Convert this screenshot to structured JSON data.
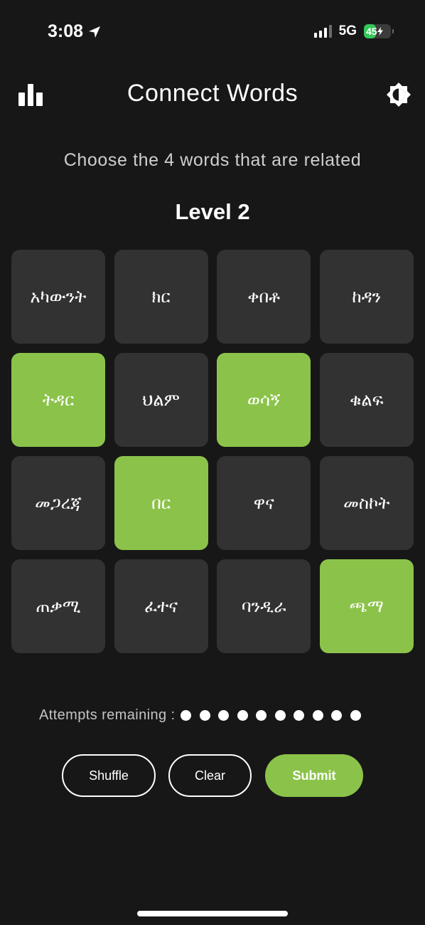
{
  "status_bar": {
    "time": "3:08",
    "network": "5G",
    "battery": "45",
    "battery_fraction": 0.45,
    "location_icon": "location-arrow-icon",
    "signal_icon": "cellular-signal-icon"
  },
  "header": {
    "title": "Connect Words",
    "stats_icon": "bar-chart-icon",
    "theme_icon": "brightness-icon"
  },
  "instruction": "Choose the 4 words that are related",
  "level": "Level 2",
  "tiles": [
    {
      "label": "አካውንት",
      "selected": false
    },
    {
      "label": "ክር",
      "selected": false
    },
    {
      "label": "ቀበቶ",
      "selected": false
    },
    {
      "label": "ከዳን",
      "selected": false
    },
    {
      "label": "ትዳር",
      "selected": true
    },
    {
      "label": "ህልም",
      "selected": false
    },
    {
      "label": "ወሳኝ",
      "selected": true
    },
    {
      "label": "ቁልፍ",
      "selected": false
    },
    {
      "label": "መጋረጃ",
      "selected": false
    },
    {
      "label": "በር",
      "selected": true
    },
    {
      "label": "ዋና",
      "selected": false
    },
    {
      "label": "መስኮት",
      "selected": false
    },
    {
      "label": "ጠቃሚ",
      "selected": false
    },
    {
      "label": "ፈተና",
      "selected": false
    },
    {
      "label": "ባንዲራ",
      "selected": false
    },
    {
      "label": "ጫማ",
      "selected": true
    }
  ],
  "attempts": {
    "label": "Attempts remaining :",
    "remaining": 10
  },
  "buttons": {
    "shuffle": "Shuffle",
    "clear": "Clear",
    "submit": "Submit"
  },
  "colors": {
    "background": "#171717",
    "tile": "#323232",
    "accent": "#8bc34a",
    "battery": "#34c759"
  }
}
